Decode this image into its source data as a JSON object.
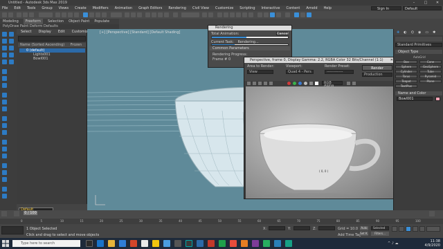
{
  "window": {
    "title": "Untitled - Autodesk 3ds Max 2019"
  },
  "menu": {
    "items": [
      "File",
      "Edit",
      "Tools",
      "Group",
      "Views",
      "Create",
      "Modifiers",
      "Animation",
      "Graph Editors",
      "Rendering",
      "Civil View",
      "Customize",
      "Scripting",
      "Interactive",
      "Content",
      "Arnold",
      "Help"
    ],
    "sign_in": "Sign In",
    "workspaces_label": "Workspaces:",
    "workspace": "Default"
  },
  "ribbon": {
    "tabs": [
      "Modeling",
      "Freeform",
      "Selection",
      "Object Paint",
      "Populate"
    ],
    "active_tab": "Freeform",
    "sub": "PolyDraw   Paint Deform   Defaults"
  },
  "explorer": {
    "tabs": [
      "Select",
      "Display",
      "Edit",
      "Customize"
    ],
    "column_header": "Name (Sorted Ascending)",
    "column_frozen": "Frozen",
    "items": [
      "0 (default)",
      "Lights001",
      "Bowl001"
    ],
    "layer": "Default"
  },
  "viewport": {
    "label": "[+] [Perspective] [Standard] [Default Shading]"
  },
  "render_frame": {
    "title": "Perspective, frame 0, Display Gamma: 2.2, RGBA Color 32 Bits/Channel (1:1)",
    "area_label": "Area to Render:",
    "area_value": "View",
    "viewport_label": "Viewport:",
    "viewport_value": "Quad 4 - Pers",
    "preset_label": "Render Preset:",
    "preset_value": "-------------",
    "render_button": "Render",
    "mode": "Production",
    "channel": "RGB Alpha",
    "overlay_value": "( 0, 0 )"
  },
  "render_dialog": {
    "title": "Rendering",
    "cancel": "Cancel",
    "total_label": "Total Animation:",
    "current_label": "Current Task:",
    "current_value": "Rendering...",
    "section": "Common Parameters",
    "progress_label": "Rendering Progress:",
    "frame_text": "Frame #  0",
    "total": 0.45,
    "current": 0.3
  },
  "command_panel": {
    "dropdown": "Standard Primitives",
    "section_object_type": "Object Type",
    "autogrid": "AutoGrid",
    "primitives": [
      "Box",
      "Cone",
      "Sphere",
      "GeoSphere",
      "Cylinder",
      "Tube",
      "Torus",
      "Pyramid",
      "Teapot",
      "Plane",
      "TextPlus"
    ],
    "section_name_color": "Name and Color",
    "object_name": "Bowl001",
    "color_swatch": "#f3a3b5"
  },
  "timeline": {
    "slider": "0 / 100",
    "ticks": [
      "0",
      "5",
      "10",
      "15",
      "20",
      "25",
      "30",
      "35",
      "40",
      "45",
      "50",
      "55",
      "60",
      "65",
      "70",
      "75",
      "80",
      "85",
      "90",
      "95",
      "100"
    ]
  },
  "status": {
    "selected": "1 Object Selected",
    "hint": "Click and drag to select and move objects",
    "x_label": "X:",
    "y_label": "Y:",
    "z_label": "Z:",
    "grid": "Grid = 10.0",
    "add_time_tag": "Add Time Tag",
    "auto": "Auto",
    "selected_mode": "Selected",
    "set_key": "Set K.",
    "filters": "Filters..."
  },
  "taskbar": {
    "search": "Type here to search",
    "time": "11:38",
    "date": "4/9/2020"
  },
  "colors": {
    "accent": "#2c6aa8",
    "viewport": "#5f8a99",
    "icon_blue": "#2d7bc4"
  }
}
